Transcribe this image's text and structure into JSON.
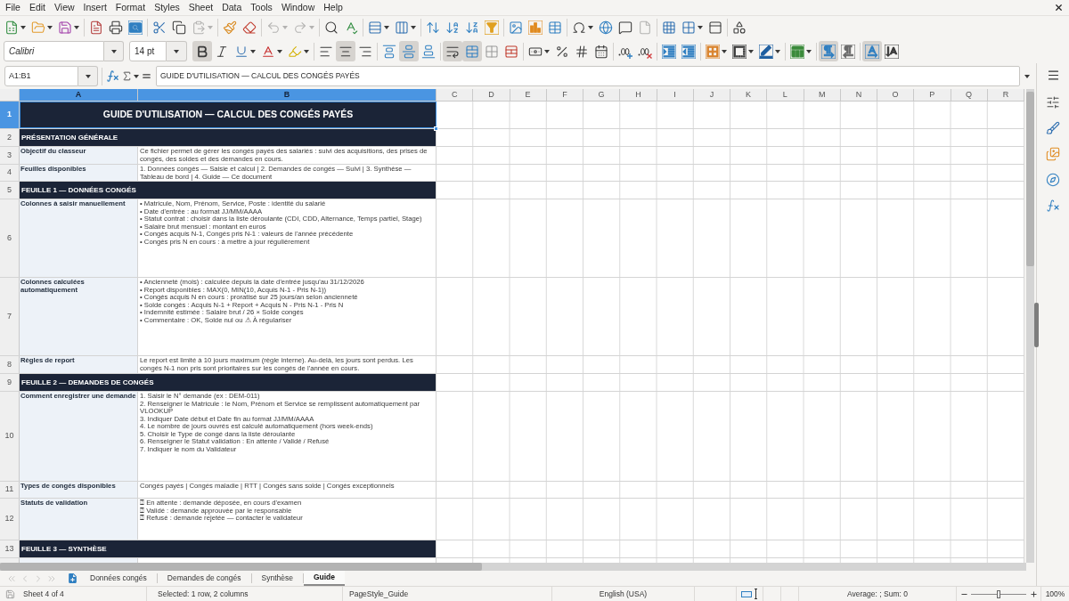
{
  "menu_bar": [
    "File",
    "Edit",
    "View",
    "Insert",
    "Format",
    "Styles",
    "Sheet",
    "Data",
    "Tools",
    "Window",
    "Help"
  ],
  "standard_toolbar": {
    "paste_disabled": true,
    "undo_disabled": true,
    "redo_disabled": true,
    "header_footer_disabled": true
  },
  "formatting_toolbar": {
    "font_name": "Calibri",
    "font_size": "14 pt",
    "toggles": {
      "bold": true,
      "italic": false,
      "underline": false,
      "align_left": false,
      "align_center": true,
      "align_right": false,
      "align_top": false,
      "align_middle": true,
      "align_bottom": false,
      "wrap_text": true,
      "merge_center": true,
      "ltr": true,
      "rtl": false,
      "text_ltr": true,
      "text_ttb": false
    }
  },
  "formula_bar": {
    "name_box": "A1:B1",
    "content": "GUIDE D'UTILISATION — CALCUL DES CONGÉS PAYÉS"
  },
  "columns": [
    {
      "label": "A",
      "selected": true
    },
    {
      "label": "B",
      "selected": true
    },
    {
      "label": "C",
      "selected": false
    },
    {
      "label": "D",
      "selected": false
    },
    {
      "label": "E",
      "selected": false
    },
    {
      "label": "F",
      "selected": false
    },
    {
      "label": "G",
      "selected": false
    },
    {
      "label": "H",
      "selected": false
    },
    {
      "label": "I",
      "selected": false
    },
    {
      "label": "J",
      "selected": false
    },
    {
      "label": "K",
      "selected": false
    },
    {
      "label": "L",
      "selected": false
    },
    {
      "label": "M",
      "selected": false
    },
    {
      "label": "N",
      "selected": false
    },
    {
      "label": "O",
      "selected": false
    },
    {
      "label": "P",
      "selected": false
    },
    {
      "label": "Q",
      "selected": false
    },
    {
      "label": "R",
      "selected": false
    }
  ],
  "rows": [
    {
      "number": "1",
      "selected": true,
      "kind": "title",
      "text": "GUIDE D'UTILISATION — CALCUL DES CONGÉS PAYÉS"
    },
    {
      "number": "2",
      "selected": false,
      "kind": "section",
      "text": "PRÉSENTATION GÉNÉRALE"
    },
    {
      "number": "3",
      "selected": false,
      "kind": "entry",
      "label": "Objectif du classeur",
      "lines": [
        "Ce fichier permet de gérer les congés payés des salariés : suivi des acquisitions, des prises de congés, des soldes et des demandes en cours."
      ]
    },
    {
      "number": "4",
      "selected": false,
      "kind": "entry",
      "label": "Feuilles disponibles",
      "lines": [
        "1. Données congés — Saisie et calcul | 2. Demandes de congés — Suivi | 3. Synthèse — Tableau de bord | 4. Guide — Ce document"
      ]
    },
    {
      "number": "5",
      "selected": false,
      "kind": "section",
      "text": "FEUILLE 1 — DONNÉES CONGÉS"
    },
    {
      "number": "6",
      "selected": false,
      "kind": "entry",
      "label": "Colonnes à saisir manuellement",
      "lines": [
        "• Matricule, Nom, Prénom, Service, Poste : identité du salarié",
        "• Date d'entrée : au format JJ/MM/AAAA",
        "• Statut contrat : choisir dans la liste déroulante (CDI, CDD, Alternance, Temps partiel, Stage)",
        "• Salaire brut mensuel : montant en euros",
        "• Congés acquis N-1, Congés pris N-1 : valeurs de l'année précédente",
        "• Congés pris N en cours : à mettre à jour régulièrement"
      ]
    },
    {
      "number": "7",
      "selected": false,
      "kind": "entry",
      "label": "Colonnes calculées automatiquement",
      "lines": [
        "• Ancienneté (mois) : calculée depuis la date d'entrée jusqu'au 31/12/2026",
        "• Report disponibles : MAX(0, MIN(10, Acquis N-1 - Pris N-1))",
        "• Congés acquis N en cours : proratisé sur 25 jours/an selon ancienneté",
        "• Solde congés : Acquis N-1 + Report + Acquis N - Pris N-1 - Pris N",
        "• Indemnité estimée : Salaire brut / 26 × Solde congés",
        "• Commentaire : OK, Solde nul ou ⚠ À régulariser"
      ]
    },
    {
      "number": "8",
      "selected": false,
      "kind": "entry",
      "label": "Règles de report",
      "lines": [
        "Le report est limité à 10 jours maximum (règle interne). Au-delà, les jours sont perdus. Les congés N-1 non pris sont prioritaires sur les congés de l'année en cours."
      ]
    },
    {
      "number": "9",
      "selected": false,
      "kind": "section",
      "text": "FEUILLE 2 — DEMANDES DE CONGÉS"
    },
    {
      "number": "10",
      "selected": false,
      "kind": "entry",
      "label": "Comment enregistrer une demande",
      "lines": [
        "1. Saisir le N° demande (ex : DEM-011)",
        "2. Renseigner le Matricule : le Nom, Prénom et Service se remplissent automatiquement par VLOOKUP",
        "3. Indiquer Date début et Date fin au format JJ/MM/AAAA",
        "4. Le nombre de jours ouvrés est calculé automatiquement (hors week-ends)",
        "5. Choisir le Type de congé dans la liste déroulante",
        "6. Renseigner le Statut validation : En attente / Validé / Refusé",
        "7. Indiquer le nom du Validateur"
      ]
    },
    {
      "number": "11",
      "selected": false,
      "kind": "entry",
      "label": "Types de congés disponibles",
      "lines": [
        "Congés payés | Congés maladie | RTT | Congés sans solde | Congés exceptionnels"
      ]
    },
    {
      "number": "12",
      "selected": false,
      "kind": "entry",
      "label": "Statuts de validation",
      "lines": [
        "⍰ En attente : demande déposée, en cours d'examen",
        "⍰ Validé : demande approuvée par le responsable",
        "⍰ Refusé : demande rejetée — contacter le validateur"
      ]
    },
    {
      "number": "13",
      "selected": false,
      "kind": "section",
      "text": "FEUILLE 3 — SYNTHÈSE"
    }
  ],
  "sheet_navigation": {
    "disabled": true
  },
  "sheet_tabs": [
    {
      "label": "Données congés",
      "selected": false
    },
    {
      "label": "Demandes de congés",
      "selected": false
    },
    {
      "label": "Synthèse",
      "selected": false
    },
    {
      "label": "Guide",
      "selected": true
    }
  ],
  "status_bar": {
    "sheet": "Sheet 4 of 4",
    "selection": "Selected: 1 row, 2 columns",
    "page_style": "PageStyle_Guide",
    "language": "English (USA)",
    "summary": "Average: ; Sum: 0",
    "zoom": {
      "level": 0.5,
      "reading": "100%"
    }
  }
}
